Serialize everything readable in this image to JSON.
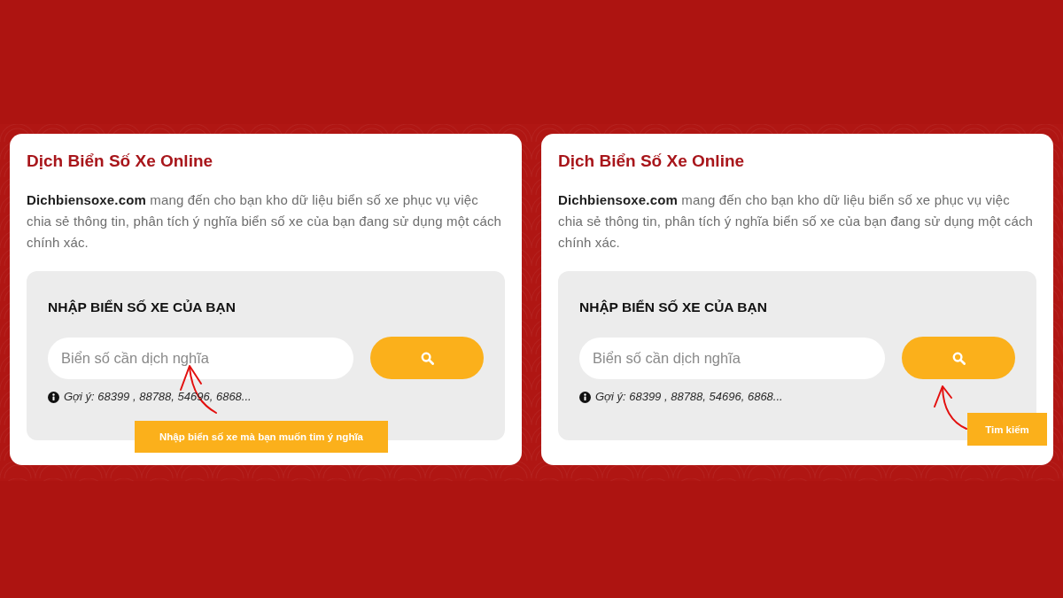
{
  "panels": [
    {
      "title": "Dịch Biển Số Xe Online",
      "intro": "**Dichbiensoxe.com** mang đến cho bạn kho dữ liệu biển số xe phục vụ việc chia sẻ thông tin, phân tích ý nghĩa biển số xe của bạn đang sử dụng một cách chính xác.",
      "search": {
        "heading": "NHẬP BIỂN SỐ XE CỦA BẠN",
        "placeholder": "Biển số cần dịch nghĩa",
        "hint": "Gợi ý: 68399 , 88788, 54696, 6868..."
      },
      "callout": {
        "kind": "field",
        "text": "Nhập biển số xe mà bạn muốn tim ý nghĩa"
      }
    },
    {
      "title": "Dịch Biển Số Xe Online",
      "intro": "**Dichbiensoxe.com** mang đến cho bạn kho dữ liệu biển số xe phục vụ việc chia sẻ thông tin, phân tích ý nghĩa biển số xe của bạn đang sử dụng một cách chính xác.",
      "search": {
        "heading": "NHẬP BIỂN SỐ XE CỦA BẠN",
        "placeholder": "Biển số cần dịch nghĩa",
        "hint": "Gợi ý: 68399 , 88788, 54696, 6868..."
      },
      "callout": {
        "kind": "button",
        "text": "Tim kiếm"
      }
    }
  ]
}
